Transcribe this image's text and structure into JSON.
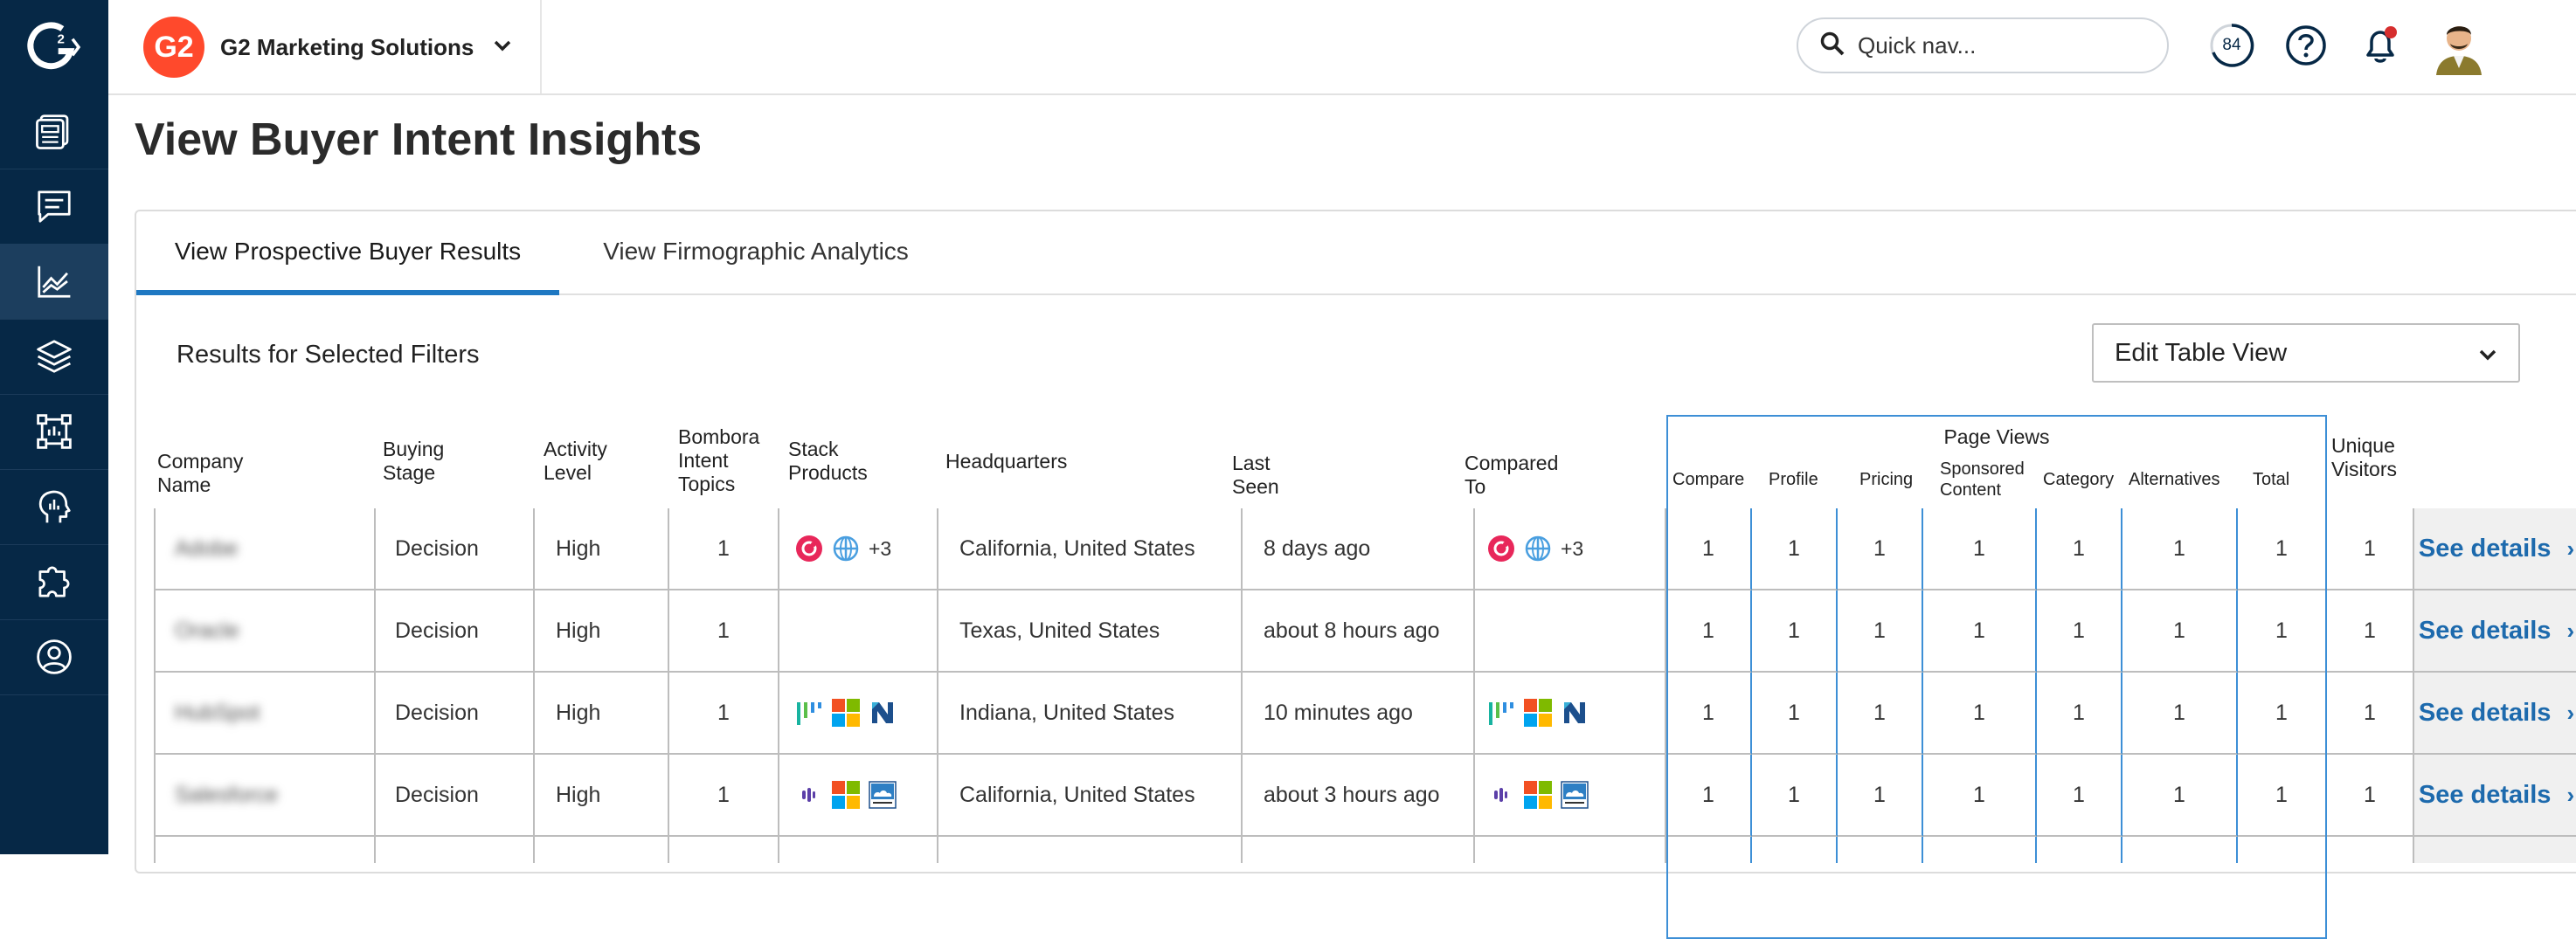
{
  "sidebar": {
    "logo_icon": "g2-logo-icon",
    "items": [
      {
        "icon": "dashboard-icon",
        "active": false
      },
      {
        "icon": "reviews-chat-icon",
        "active": false
      },
      {
        "icon": "analytics-chart-icon",
        "active": true
      },
      {
        "icon": "layers-icon",
        "active": false
      },
      {
        "icon": "frame-icon",
        "active": false
      },
      {
        "icon": "head-insights-icon",
        "active": false
      },
      {
        "icon": "puzzle-icon",
        "active": false
      },
      {
        "icon": "user-profile-icon",
        "active": false
      }
    ]
  },
  "topbar": {
    "org_logo_text": "G2",
    "org_name": "G2 Marketing Solutions",
    "quicknav_placeholder": "Quick nav...",
    "score_badge": "84",
    "help_icon": "help-icon",
    "notification_icon": "bell-icon",
    "avatar": "avatar"
  },
  "page": {
    "title": "View Buyer Intent Insights",
    "tabs": [
      {
        "label": "View Prospective Buyer Results",
        "active": true
      },
      {
        "label": "View Firmographic Analytics",
        "active": false
      }
    ],
    "results_label": "Results for Selected Filters",
    "edit_table_label": "Edit Table View"
  },
  "table": {
    "headers": {
      "company": "Company Name",
      "buying_stage": [
        "Buying",
        "Stage"
      ],
      "activity": [
        "Activity",
        "Level"
      ],
      "bombora": [
        "Bombora",
        "Intent",
        "Topics"
      ],
      "stack": [
        "Stack",
        "Products"
      ],
      "hq": "Headquarters",
      "last_seen": "Last Seen",
      "compared": "Compared To",
      "page_views": "Page Views",
      "pv_compare": "Compare",
      "pv_profile": "Profile",
      "pv_pricing": "Pricing",
      "pv_sponsored": [
        "Sponsored",
        "Content"
      ],
      "pv_category": "Category",
      "pv_alternatives": "Alternatives",
      "pv_total": "Total",
      "unique": [
        "Unique",
        "Visitors"
      ]
    },
    "rows": [
      {
        "company": "Adobe",
        "stage": "Decision",
        "activity": "High",
        "bombora": "1",
        "stack": [
          "g2-red-logo",
          "globe-logo",
          "+3"
        ],
        "hq": "California, United States",
        "last_seen": "8 days ago",
        "compared": [
          "g2-red-logo",
          "globe-logo",
          "+3"
        ],
        "compare": "1",
        "profile": "1",
        "pricing": "1",
        "sponsored": "1",
        "category": "1",
        "alternatives": "1",
        "total": "1",
        "unique": "1",
        "details": "See details"
      },
      {
        "company": "Oracle",
        "stage": "Decision",
        "activity": "High",
        "bombora": "1",
        "stack": [],
        "hq": "Texas, United States",
        "last_seen": "about 8 hours ago",
        "compared": [],
        "compare": "1",
        "profile": "1",
        "pricing": "1",
        "sponsored": "1",
        "category": "1",
        "alternatives": "1",
        "total": "1",
        "unique": "1",
        "details": "See details"
      },
      {
        "company": "HubSpot",
        "stage": "Decision",
        "activity": "High",
        "bombora": "1",
        "stack": [
          "bars-logo",
          "microsoft-logo",
          "n-logo"
        ],
        "hq": "Indiana, United States",
        "last_seen": "10 minutes ago",
        "compared": [
          "bars-logo",
          "microsoft-logo",
          "n-logo"
        ],
        "compare": "1",
        "profile": "1",
        "pricing": "1",
        "sponsored": "1",
        "category": "1",
        "alternatives": "1",
        "total": "1",
        "unique": "1",
        "details": "See details"
      },
      {
        "company": "Salesforce",
        "stage": "Decision",
        "activity": "High",
        "bombora": "1",
        "stack": [
          "purple-bars-logo",
          "microsoft-logo",
          "cloud-logo"
        ],
        "hq": "California, United States",
        "last_seen": "about 3 hours ago",
        "compared": [
          "purple-bars-logo",
          "microsoft-logo",
          "cloud-logo"
        ],
        "compare": "1",
        "profile": "1",
        "pricing": "1",
        "sponsored": "1",
        "category": "1",
        "alternatives": "1",
        "total": "1",
        "unique": "1",
        "details": "See details"
      }
    ]
  },
  "colors": {
    "sidebar_bg": "#062846",
    "accent_blue": "#1e78c2",
    "g2_red": "#ff492c",
    "link_blue": "#1d6aad"
  }
}
